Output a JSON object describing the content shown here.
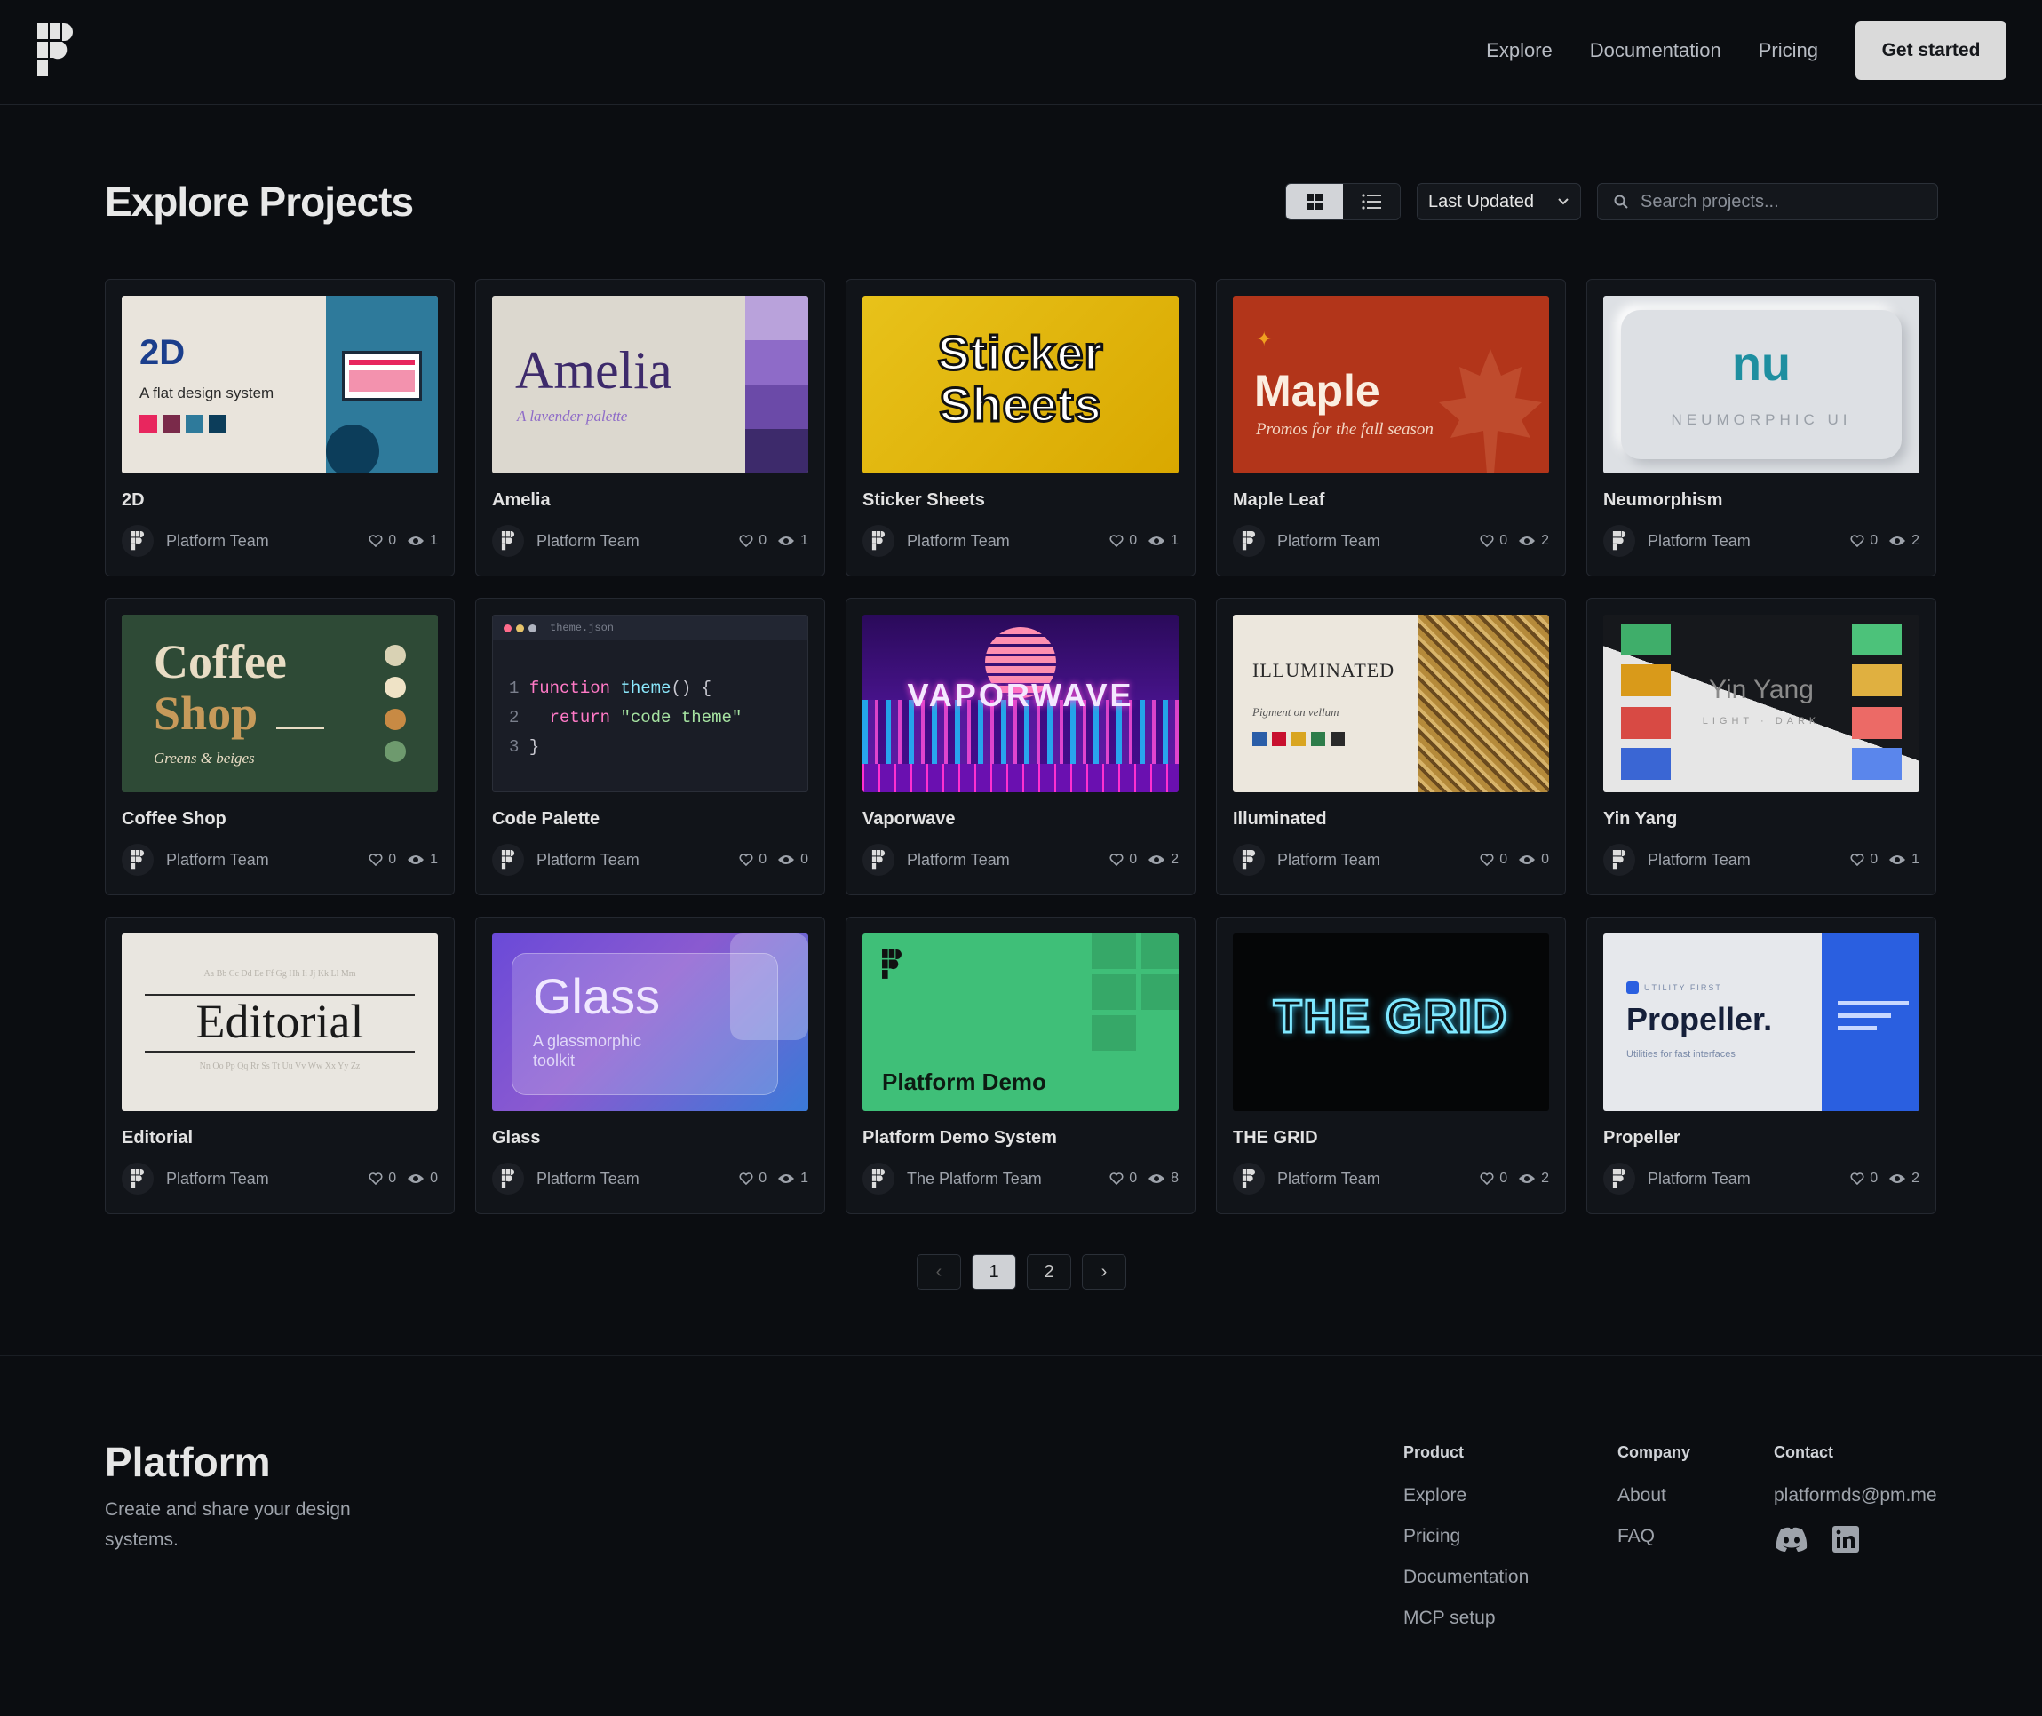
{
  "nav": {
    "items": [
      "Explore",
      "Documentation",
      "Pricing"
    ],
    "cta": "Get started"
  },
  "page": {
    "title": "Explore Projects"
  },
  "toolbar": {
    "sort": "Last Updated",
    "search_placeholder": "Search projects..."
  },
  "projects": [
    {
      "name": "2D",
      "team": "Platform Team",
      "likes": "0",
      "views": "1"
    },
    {
      "name": "Amelia",
      "team": "Platform Team",
      "likes": "0",
      "views": "1"
    },
    {
      "name": "Sticker Sheets",
      "team": "Platform Team",
      "likes": "0",
      "views": "1"
    },
    {
      "name": "Maple Leaf",
      "team": "Platform Team",
      "likes": "0",
      "views": "2"
    },
    {
      "name": "Neumorphism",
      "team": "Platform Team",
      "likes": "0",
      "views": "2"
    },
    {
      "name": "Coffee Shop",
      "team": "Platform Team",
      "likes": "0",
      "views": "1"
    },
    {
      "name": "Code Palette",
      "team": "Platform Team",
      "likes": "0",
      "views": "0"
    },
    {
      "name": "Vaporwave",
      "team": "Platform Team",
      "likes": "0",
      "views": "2"
    },
    {
      "name": "Illuminated",
      "team": "Platform Team",
      "likes": "0",
      "views": "0"
    },
    {
      "name": "Yin Yang",
      "team": "Platform Team",
      "likes": "0",
      "views": "1"
    },
    {
      "name": "Editorial",
      "team": "Platform Team",
      "likes": "0",
      "views": "0"
    },
    {
      "name": "Glass",
      "team": "Platform Team",
      "likes": "0",
      "views": "1"
    },
    {
      "name": "Platform Demo System",
      "team": "The Platform Team",
      "likes": "0",
      "views": "8"
    },
    {
      "name": "THE GRID",
      "team": "Platform Team",
      "likes": "0",
      "views": "2"
    },
    {
      "name": "Propeller",
      "team": "Platform Team",
      "likes": "0",
      "views": "2"
    }
  ],
  "thumbs": {
    "t2d": {
      "big": "2D",
      "sub": "A flat design system"
    },
    "amelia": {
      "big": "Amelia",
      "sub": "A lavender palette"
    },
    "sticker": {
      "l1": "Sticker",
      "l2": "Sheets"
    },
    "maple": {
      "big": "Maple",
      "sub": "Promos for the fall season"
    },
    "neu": {
      "big": "nu",
      "sub": "NEUMORPHIC UI"
    },
    "coffee": {
      "l1": "Coffee",
      "l2": "Shop",
      "sub": "Greens & beiges"
    },
    "code": {
      "file": "theme.json",
      "n1": "1",
      "n2": "2",
      "n3": "3",
      "kw1": "function",
      "fn": "theme",
      "paren": "() {",
      "kw2": "return",
      "str": "\"code theme\"",
      "close": "}"
    },
    "vapor": {
      "big": "VAPORWAVE"
    },
    "illum": {
      "big": "ILLUMINATED",
      "sub": "Pigment on vellum"
    },
    "yin": {
      "big": "Yin Yang",
      "sub": "LIGHT · DARK"
    },
    "editorial": {
      "big": "Editorial",
      "top": "Aa Bb Cc Dd Ee Ff Gg Hh Ii Jj Kk Ll Mm",
      "bot": "Nn Oo Pp Qq Rr Ss Tt Uu Vv Ww Xx Yy Zz"
    },
    "glass": {
      "big": "Glass",
      "sub1": "A glassmorphic",
      "sub2": "toolkit"
    },
    "demo": {
      "big": "Platform Demo"
    },
    "grid": {
      "big": "THE GRID"
    },
    "prop": {
      "tag": "UTILITY FIRST",
      "big": "Propeller.",
      "sub": "Utilities for fast interfaces"
    }
  },
  "pagination": {
    "prev": "‹",
    "pages": [
      "1",
      "2"
    ],
    "next": "›"
  },
  "footer": {
    "brand": "Platform",
    "tagline": "Create and share your design systems.",
    "product": {
      "heading": "Product",
      "links": [
        "Explore",
        "Pricing",
        "Documentation",
        "MCP setup"
      ]
    },
    "company": {
      "heading": "Company",
      "links": [
        "About",
        "FAQ"
      ]
    },
    "contact": {
      "heading": "Contact",
      "email": "platformds@pm.me"
    }
  },
  "icons": [
    "logo-icon",
    "grid-view-icon",
    "list-view-icon",
    "chevron-down-icon",
    "search-icon",
    "heart-icon",
    "eye-icon",
    "discord-icon",
    "linkedin-icon"
  ]
}
